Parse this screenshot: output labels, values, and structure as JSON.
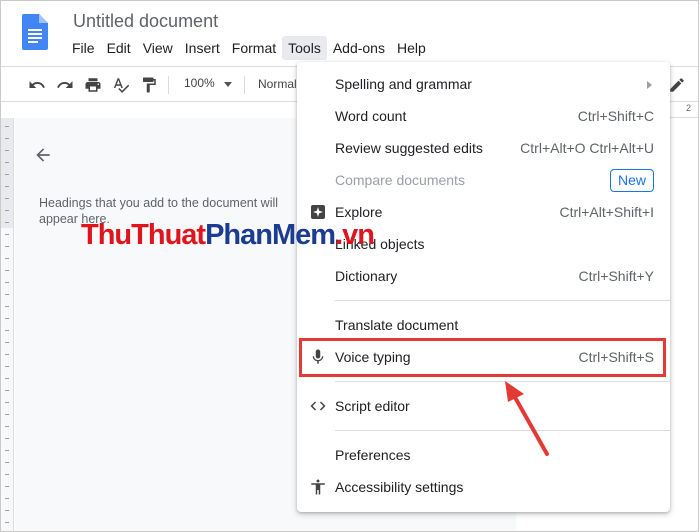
{
  "document": {
    "title": "Untitled document"
  },
  "menubar": {
    "items": [
      "File",
      "Edit",
      "View",
      "Insert",
      "Format",
      "Tools",
      "Add-ons",
      "Help"
    ],
    "active": "Tools"
  },
  "toolbar": {
    "zoom": "100%",
    "style": "Normal",
    "ruler_number": "2"
  },
  "outline": {
    "hint": "Headings that you add to the document will appear here."
  },
  "watermark": {
    "part1": "ThuThuat",
    "part2": "PhanMem",
    "part3": ".vn"
  },
  "tools_menu": {
    "items": [
      {
        "label": "Spelling and grammar",
        "shortcut": "",
        "icon": "",
        "submenu": true,
        "disabled": false
      },
      {
        "label": "Word count",
        "shortcut": "Ctrl+Shift+C",
        "icon": "",
        "disabled": false
      },
      {
        "label": "Review suggested edits",
        "shortcut": "Ctrl+Alt+O Ctrl+Alt+U",
        "icon": "",
        "disabled": false
      },
      {
        "label": "Compare documents",
        "shortcut": "",
        "badge": "New",
        "icon": "",
        "disabled": true
      },
      {
        "label": "Explore",
        "shortcut": "Ctrl+Alt+Shift+I",
        "icon": "explore-icon",
        "disabled": false
      },
      {
        "label": "Linked objects",
        "shortcut": "",
        "icon": "",
        "disabled": false
      },
      {
        "label": "Dictionary",
        "shortcut": "Ctrl+Shift+Y",
        "icon": "",
        "disabled": false
      },
      {
        "label": "Translate document",
        "shortcut": "",
        "icon": "",
        "disabled": false
      },
      {
        "label": "Voice typing",
        "shortcut": "Ctrl+Shift+S",
        "icon": "microphone-icon",
        "disabled": false,
        "highlighted": true
      },
      {
        "label": "Script editor",
        "shortcut": "",
        "icon": "code-icon",
        "disabled": false
      },
      {
        "label": "Preferences",
        "shortcut": "",
        "icon": "",
        "disabled": false
      },
      {
        "label": "Accessibility settings",
        "shortcut": "",
        "icon": "accessibility-icon",
        "disabled": false
      }
    ]
  },
  "colors": {
    "highlight": "#e53935",
    "accent": "#1a73e8",
    "docs_blue": "#4285f4"
  }
}
